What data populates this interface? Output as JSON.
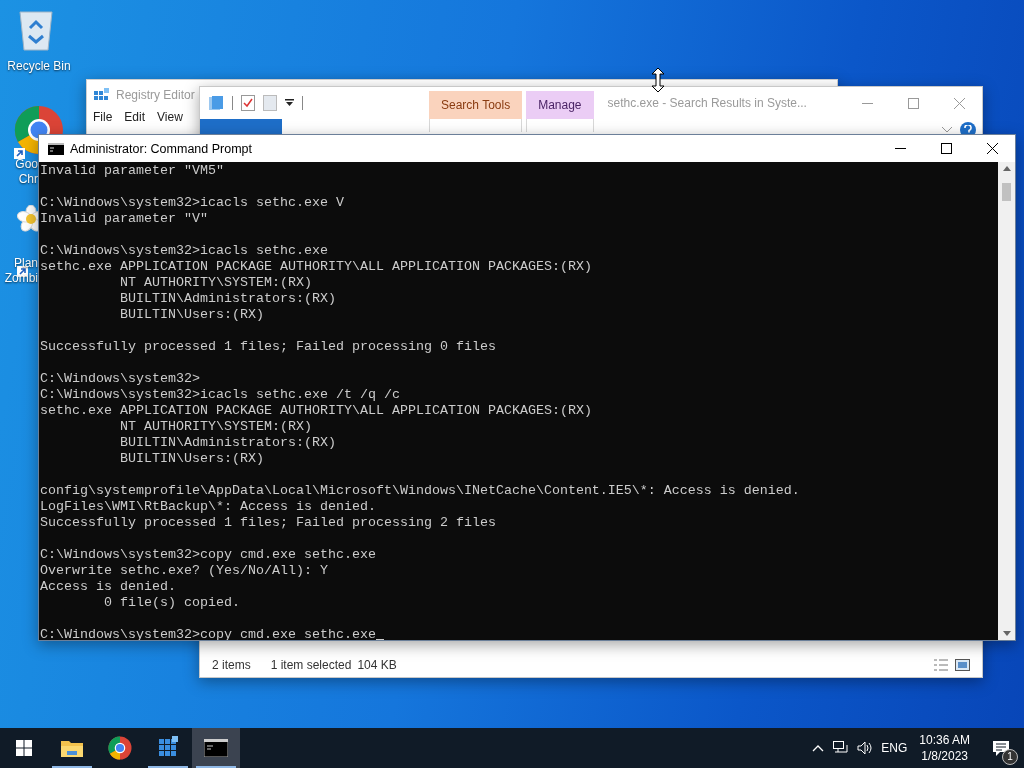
{
  "desktop_icons": [
    {
      "kind": "recycle_bin",
      "label_lines": [
        "Recycle Bin"
      ],
      "shortcut": false
    },
    {
      "kind": "browser",
      "label_lines": [
        "Goo",
        "Chr"
      ],
      "shortcut": true
    },
    {
      "kind": "flower",
      "label_lines": [
        "Plan",
        "Zombi"
      ],
      "shortcut": true
    }
  ],
  "registry_editor": {
    "title": "Registry Editor",
    "menu": [
      "File",
      "Edit",
      "View"
    ]
  },
  "explorer": {
    "title": "sethc.exe - Search Results in Syste...",
    "context_tabs": [
      {
        "group": "Search Tools",
        "color": "#fad3bd"
      },
      {
        "group": "Manage",
        "color": "#ebcdf5"
      }
    ],
    "status": {
      "item_count": "2 items",
      "selection": "1 item selected",
      "size": "104 KB"
    }
  },
  "command_prompt": {
    "title": "Administrator: Command Prompt",
    "caret": true,
    "lines": [
      {
        "kind": "text",
        "text": "Invalid parameter \"VM5\""
      },
      {
        "kind": "blank"
      },
      {
        "kind": "text",
        "text": "C:\\Windows\\system32>icacls sethc.exe V"
      },
      {
        "kind": "text",
        "text": "Invalid parameter \"V\""
      },
      {
        "kind": "blank"
      },
      {
        "kind": "text",
        "text": "C:\\Windows\\system32>icacls sethc.exe"
      },
      {
        "kind": "text",
        "text": "sethc.exe APPLICATION PACKAGE AUTHORITY\\ALL APPLICATION PACKAGES:(RX)"
      },
      {
        "kind": "text",
        "text": "          NT AUTHORITY\\SYSTEM:(RX)"
      },
      {
        "kind": "text",
        "text": "          BUILTIN\\Administrators:(RX)"
      },
      {
        "kind": "text",
        "text": "          BUILTIN\\Users:(RX)"
      },
      {
        "kind": "blank"
      },
      {
        "kind": "text",
        "text": "Successfully processed 1 files; Failed processing 0 files"
      },
      {
        "kind": "blank"
      },
      {
        "kind": "text",
        "text": "C:\\Windows\\system32>"
      },
      {
        "kind": "text",
        "text": "C:\\Windows\\system32>icacls sethc.exe /t /q /c"
      },
      {
        "kind": "text",
        "text": "sethc.exe APPLICATION PACKAGE AUTHORITY\\ALL APPLICATION PACKAGES:(RX)"
      },
      {
        "kind": "text",
        "text": "          NT AUTHORITY\\SYSTEM:(RX)"
      },
      {
        "kind": "text",
        "text": "          BUILTIN\\Administrators:(RX)"
      },
      {
        "kind": "text",
        "text": "          BUILTIN\\Users:(RX)"
      },
      {
        "kind": "blank"
      },
      {
        "kind": "text",
        "text": "config\\systemprofile\\AppData\\Local\\Microsoft\\Windows\\INetCache\\Content.IE5\\*: Access is denied."
      },
      {
        "kind": "text",
        "text": "LogFiles\\WMI\\RtBackup\\*: Access is denied."
      },
      {
        "kind": "text",
        "text": "Successfully processed 1 files; Failed processing 2 files"
      },
      {
        "kind": "blank"
      },
      {
        "kind": "text",
        "text": "C:\\Windows\\system32>copy cmd.exe sethc.exe"
      },
      {
        "kind": "text",
        "text": "Overwrite sethc.exe? (Yes/No/All): Y"
      },
      {
        "kind": "text",
        "text": "Access is denied."
      },
      {
        "kind": "text",
        "text": "        0 file(s) copied."
      },
      {
        "kind": "blank"
      },
      {
        "kind": "text",
        "text": "C:\\Windows\\system32>copy cmd.exe sethc.exe"
      }
    ]
  },
  "taskbar": {
    "apps": [
      {
        "kind": "explorer",
        "running": true,
        "active": false
      },
      {
        "kind": "browser",
        "running": false,
        "active": false
      },
      {
        "kind": "registry",
        "running": true,
        "active": false
      },
      {
        "kind": "console",
        "running": true,
        "active": true
      }
    ],
    "tray": {
      "language": "ENG",
      "time": "10:36 AM",
      "date": "1/8/2023",
      "notification_count": "1"
    }
  }
}
